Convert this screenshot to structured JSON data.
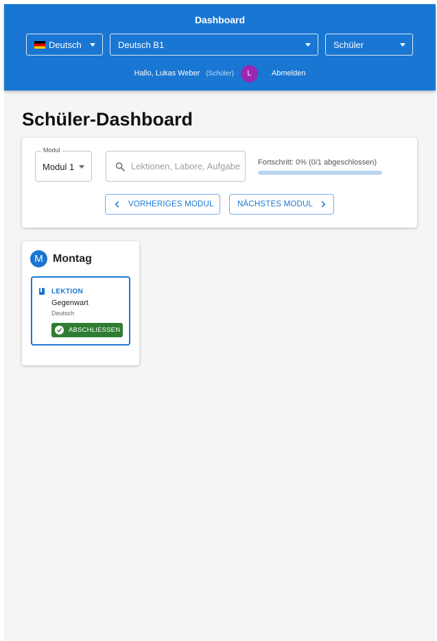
{
  "appbar": {
    "title": "Dashboard",
    "language_select": "Deutsch",
    "course_select": "Deutsch B1",
    "role_select": "Schüler",
    "greeting": "Hallo, Lukas Weber",
    "role_tag": "(Schüler)",
    "avatar_initial": "L",
    "logout": "Abmelden"
  },
  "page": {
    "title": "Schüler-Dashboard"
  },
  "controls": {
    "module_label": "Modul",
    "module_value": "Modul 1",
    "search_placeholder": "Lektionen, Labore, Aufgaben",
    "progress_text": "Fortschritt: 0% (0/1 abgeschlossen)",
    "progress_fraction": 0,
    "prev_button": "VORHERIGES MODUL",
    "next_button": "NÄCHSTES MODUL"
  },
  "days": [
    {
      "initial": "M",
      "name": "Montag",
      "items": [
        {
          "type": "LEKTION",
          "name": "Gegenwart",
          "subject": "Deutsch",
          "action": "ABSCHLIESSEN"
        }
      ]
    }
  ],
  "colors": {
    "primary": "#1976d2",
    "success": "#2e7d32",
    "avatar": "#9c27b0",
    "background": "#f5f5f5"
  }
}
